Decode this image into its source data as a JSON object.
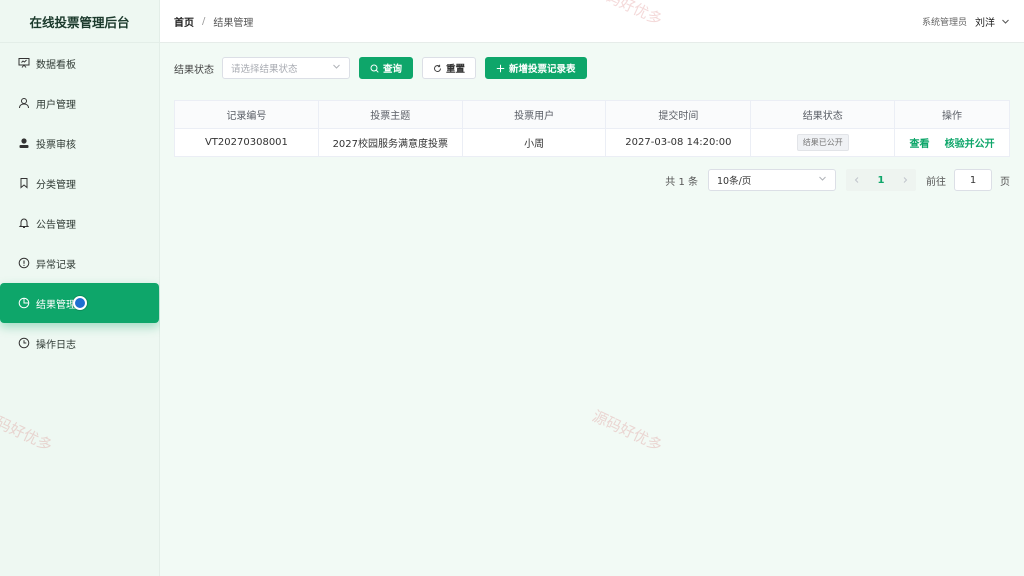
{
  "app": {
    "title": "在线投票管理后台"
  },
  "sidebar": {
    "items": [
      {
        "label": "数据看板",
        "icon": "easel-icon"
      },
      {
        "label": "用户管理",
        "icon": "user-icon"
      },
      {
        "label": "投票审核",
        "icon": "user-filled-icon"
      },
      {
        "label": "分类管理",
        "icon": "bookmark-icon"
      },
      {
        "label": "公告管理",
        "icon": "bell-icon"
      },
      {
        "label": "异常记录",
        "icon": "warning-circle-icon"
      },
      {
        "label": "结果管理",
        "icon": "pie-chart-icon",
        "active": true
      },
      {
        "label": "操作日志",
        "icon": "clock-icon"
      }
    ]
  },
  "header": {
    "breadcrumb": {
      "home": "首页",
      "separator": "/",
      "current": "结果管理"
    },
    "user": {
      "role": "系统管理员",
      "name": "刘洋"
    }
  },
  "filter": {
    "label": "结果状态",
    "select_placeholder": "请选择结果状态",
    "search_label": "查询",
    "reset_label": "重置",
    "add_label": "新增投票记录表"
  },
  "table": {
    "columns": [
      "记录编号",
      "投票主题",
      "投票用户",
      "提交时间",
      "结果状态",
      "操作"
    ],
    "rows": [
      {
        "id": "VT20270308001",
        "topic": "2027校园服务满意度投票",
        "user": "小周",
        "time": "2027-03-08 14:20:00",
        "status": "结果已公开",
        "actions": [
          "查看",
          "核验并公开"
        ]
      }
    ]
  },
  "pagination": {
    "total_text": "共 1 条",
    "page_size": "10条/页",
    "current_page": "1",
    "goto_label": "前往",
    "goto_value": "1",
    "page_unit": "页"
  },
  "watermark": "源码好优多",
  "colors": {
    "accent": "#0ea66a",
    "sidebar_bg": "#eef8f2",
    "main_bg": "#f2faf5"
  }
}
